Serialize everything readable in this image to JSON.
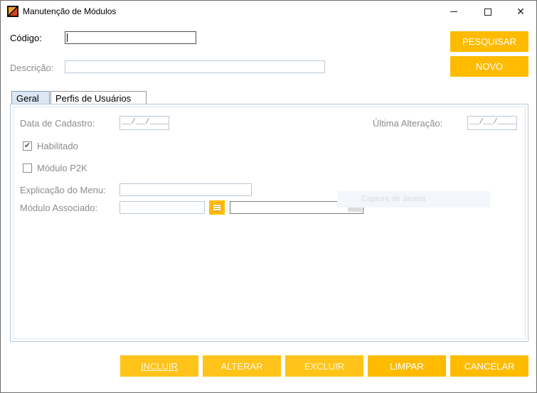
{
  "window": {
    "title": "Manutenção de Módulos",
    "controls": {
      "minimize": "—",
      "maximize": "☐",
      "close": "✕"
    }
  },
  "header": {
    "codigo_label": "Código:",
    "codigo_value": "",
    "descricao_label": "Descrição:",
    "descricao_value": "",
    "pesquisar_label": "PESQUISAR",
    "novo_label": "NOVO"
  },
  "tabs": [
    {
      "label": "Geral",
      "selected": true
    },
    {
      "label": "Perfis de Usuários",
      "selected": false
    }
  ],
  "geral": {
    "data_cadastro_label": "Data de Cadastro:",
    "data_cadastro_value": "__/__/____",
    "ultima_alteracao_label": "Última Alteração:",
    "ultima_alteracao_value": "__/__/____",
    "habilitado_label": "Habilitado",
    "habilitado_checked": true,
    "modulo_p2k_label": "Módulo P2K",
    "modulo_p2k_checked": false,
    "explicacao_label": "Explicação do Menu:",
    "explicacao_value": "",
    "modulo_associado_label": "Módulo Associado:",
    "modulo_associado_value": "",
    "modulo_associado_combo_value": "",
    "ghost_text": "Captura de Janela"
  },
  "footer": {
    "incluir_label": "INCLUIR",
    "alterar_label": "ALTERAR",
    "excluir_label": "EXCLUIR",
    "limpar_label": "LIMPAR",
    "cancelar_label": "CANCELAR"
  },
  "colors": {
    "accent": "#ffbb00",
    "input_border": "#b9c8d6",
    "disabled_text": "#8c8c8c",
    "selected_tab": "#dbe7f3"
  }
}
